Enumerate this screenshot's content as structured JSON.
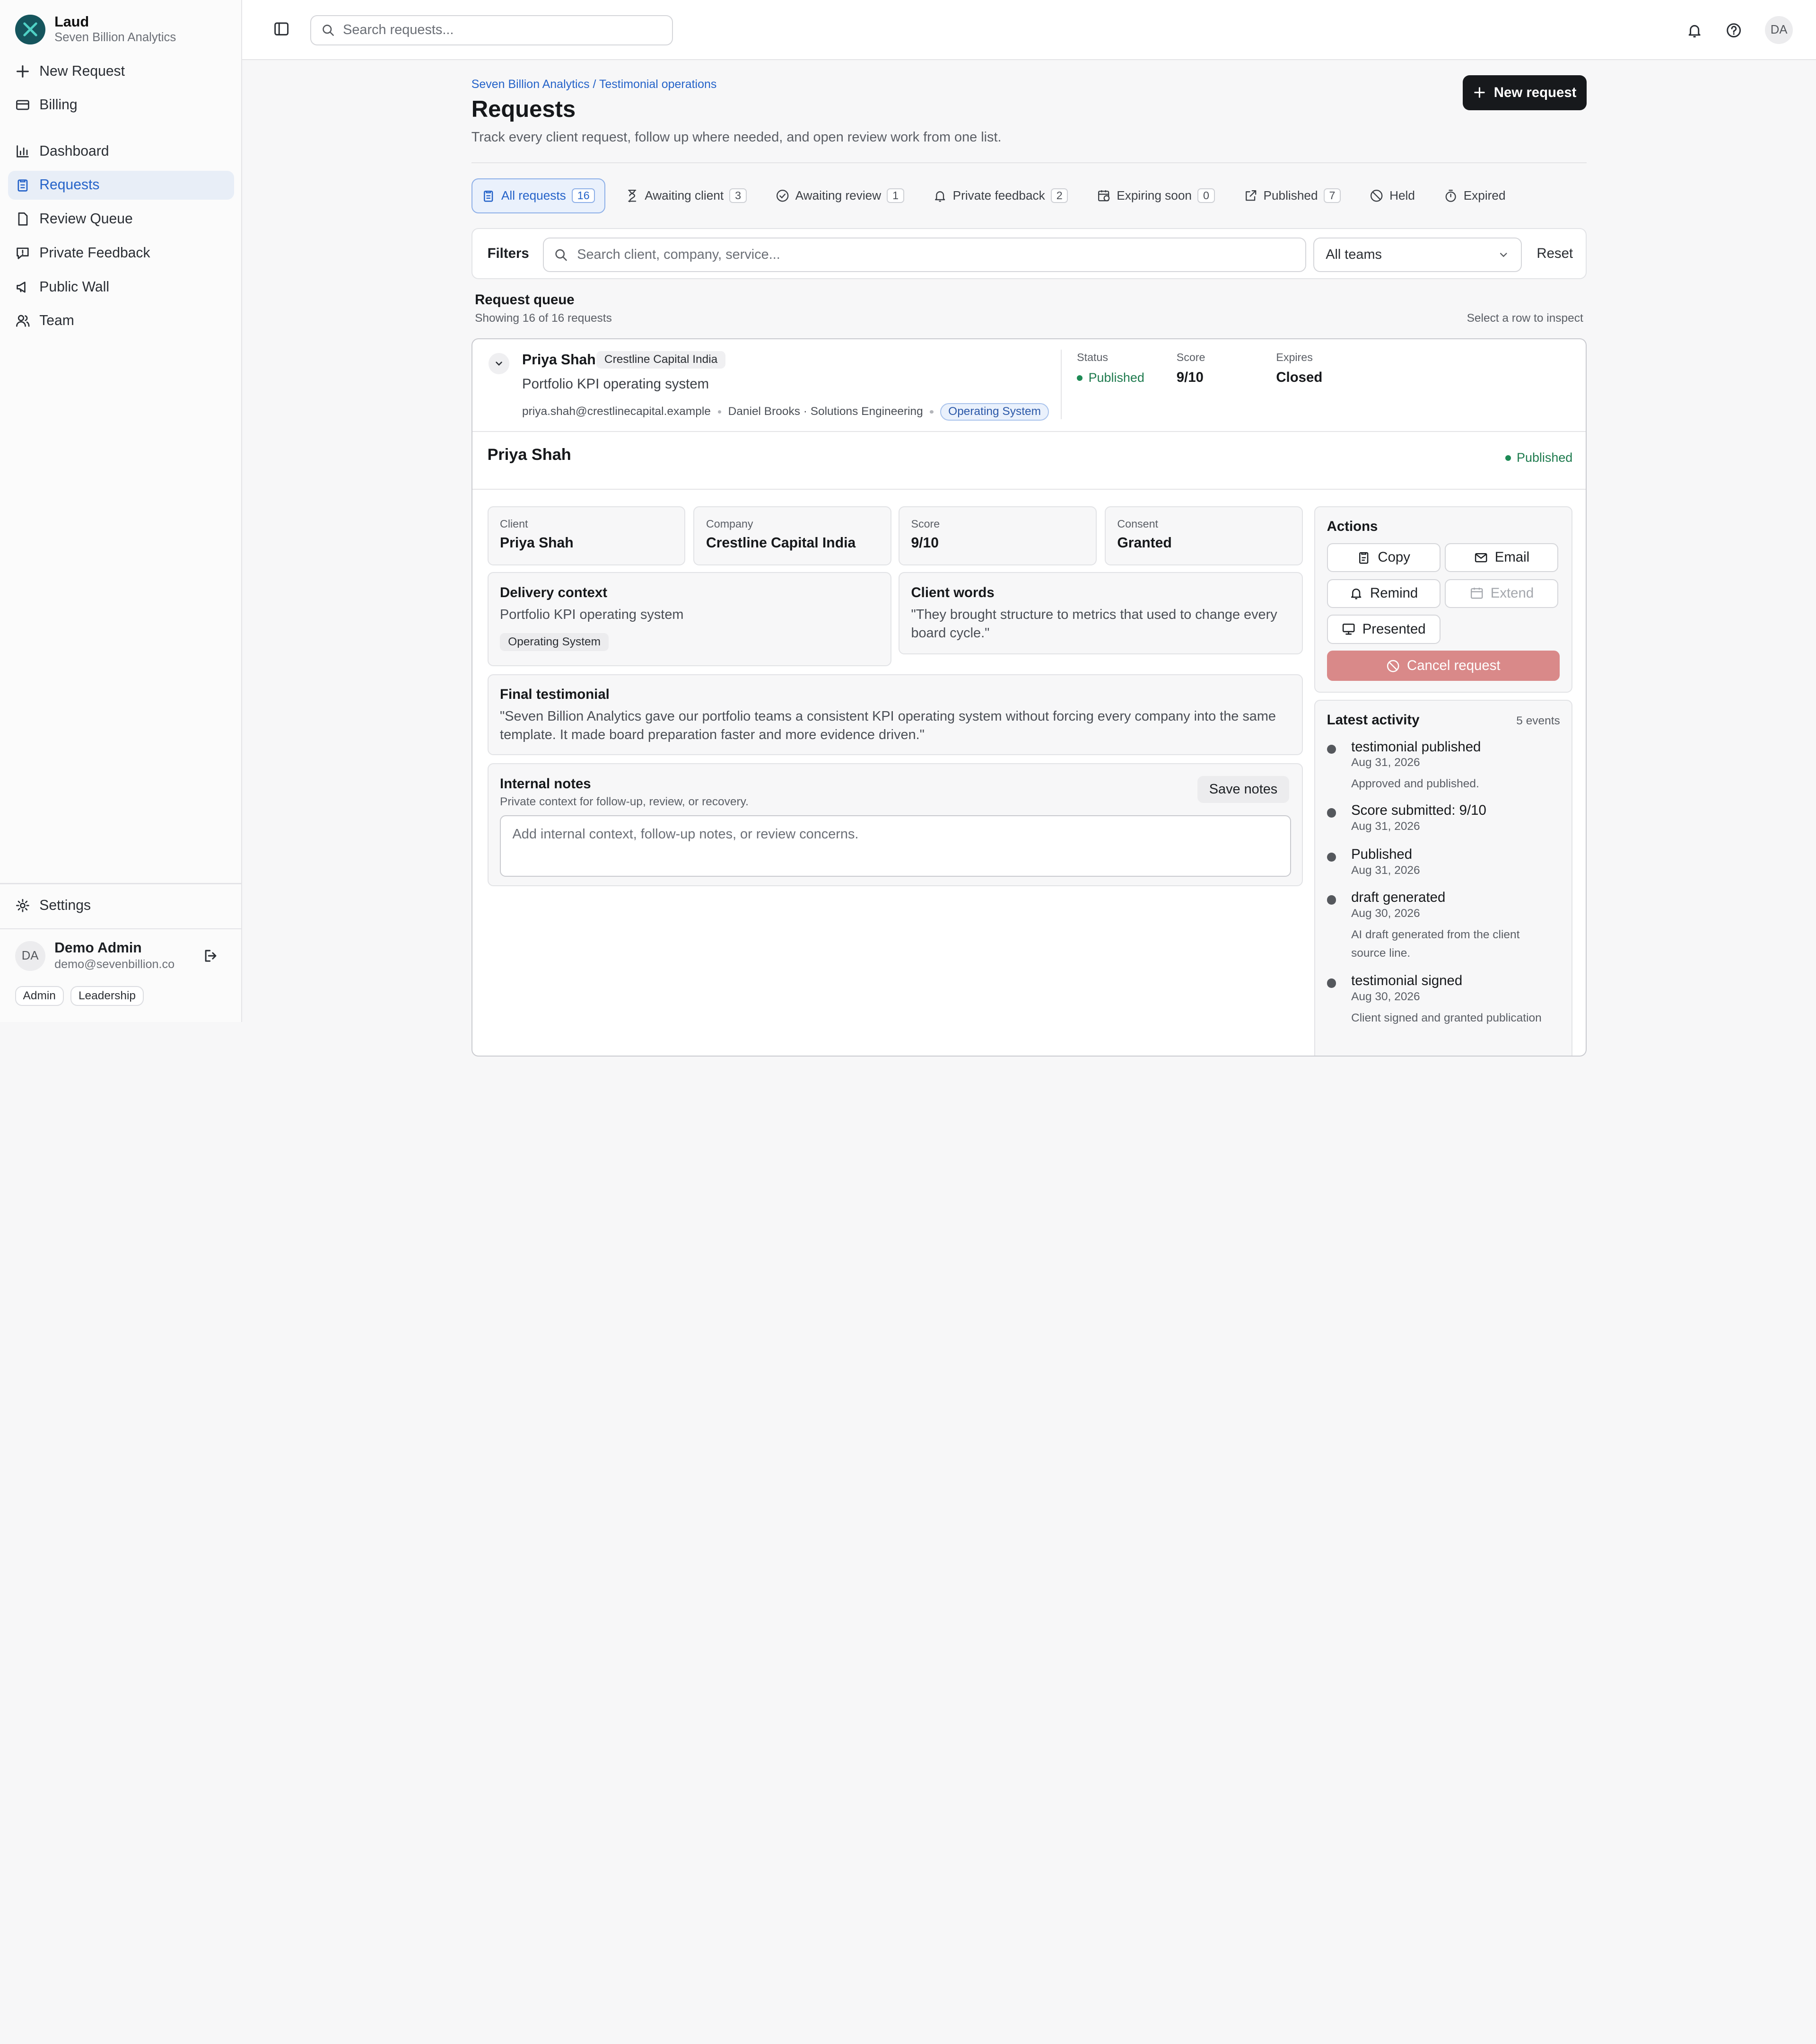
{
  "app": {
    "name": "Laud",
    "org": "Seven Billion Analytics"
  },
  "sidebar": {
    "top_items": [
      {
        "label": "New Request",
        "icon": "plus-icon"
      },
      {
        "label": "Billing",
        "icon": "credit-card-icon"
      }
    ],
    "items": [
      {
        "label": "Dashboard",
        "icon": "bar-chart-icon"
      },
      {
        "label": "Requests",
        "icon": "clipboard-icon",
        "active": true
      },
      {
        "label": "Review Queue",
        "icon": "file-icon"
      },
      {
        "label": "Private Feedback",
        "icon": "message-alert-icon"
      },
      {
        "label": "Public Wall",
        "icon": "megaphone-icon"
      },
      {
        "label": "Team",
        "icon": "users-icon"
      }
    ],
    "settings_label": "Settings",
    "user": {
      "initials": "DA",
      "name": "Demo Admin",
      "email": "demo@sevenbillion.co",
      "roles": [
        "Admin",
        "Leadership"
      ]
    }
  },
  "topbar": {
    "search_placeholder": "Search requests...",
    "avatar_initials": "DA"
  },
  "page": {
    "breadcrumb": "Seven Billion Analytics / Testimonial operations",
    "title": "Requests",
    "subtitle": "Track every client request, follow up where needed, and open review work from one list.",
    "new_button": "New request"
  },
  "tabs": [
    {
      "label": "All requests",
      "count": "16",
      "icon": "clipboard-icon",
      "active": true
    },
    {
      "label": "Awaiting client",
      "count": "3",
      "icon": "hourglass-icon"
    },
    {
      "label": "Awaiting review",
      "count": "1",
      "icon": "check-circle-icon"
    },
    {
      "label": "Private feedback",
      "count": "2",
      "icon": "bell-icon"
    },
    {
      "label": "Expiring soon",
      "count": "0",
      "icon": "calendar-clock-icon"
    },
    {
      "label": "Published",
      "count": "7",
      "icon": "external-link-icon"
    },
    {
      "label": "Held",
      "count": "",
      "icon": "ban-icon"
    },
    {
      "label": "Expired",
      "count": "",
      "icon": "timer-off-icon"
    }
  ],
  "filters": {
    "label": "Filters",
    "search_placeholder": "Search client, company, service...",
    "team": "All teams",
    "reset": "Reset"
  },
  "queue": {
    "title": "Request queue",
    "subtitle": "Showing 16 of 16 requests",
    "hint": "Select a row to inspect"
  },
  "request": {
    "name": "Priya Shah",
    "company": "Crestline Capital India",
    "service": "Portfolio KPI operating system",
    "email": "priya.shah@crestlinecapital.example",
    "owner": "Daniel Brooks · Solutions Engineering",
    "category": "Operating System",
    "status_label": "Status",
    "status": "Published",
    "score_label": "Score",
    "score": "9/10",
    "expires_label": "Expires",
    "expires": "Closed"
  },
  "detail": {
    "name": "Priya Shah",
    "status": "Published",
    "fields": [
      {
        "label": "Client",
        "value": "Priya Shah"
      },
      {
        "label": "Company",
        "value": "Crestline Capital India"
      },
      {
        "label": "Score",
        "value": "9/10"
      },
      {
        "label": "Consent",
        "value": "Granted"
      }
    ],
    "delivery_title": "Delivery context",
    "delivery_text": "Portfolio KPI operating system",
    "delivery_tag": "Operating System",
    "words_title": "Client words",
    "words_text": "\"They brought structure to metrics that used to change every board cycle.\"",
    "final_title": "Final testimonial",
    "final_text": "\"Seven Billion Analytics gave our portfolio teams a consistent KPI operating system without forcing every company into the same template. It made board preparation faster and more evidence driven.\"",
    "notes_title": "Internal notes",
    "notes_sub": "Private context for follow-up, review, or recovery.",
    "notes_placeholder": "Add internal context, follow-up notes, or review concerns.",
    "save_notes": "Save notes"
  },
  "actions": {
    "title": "Actions",
    "copy": "Copy",
    "email": "Email",
    "remind": "Remind",
    "extend": "Extend",
    "presented": "Presented",
    "cancel": "Cancel request"
  },
  "activity": {
    "title": "Latest activity",
    "count": "5 events",
    "events": [
      {
        "title": "testimonial published",
        "date": "Aug 31, 2026",
        "note": "Approved and published."
      },
      {
        "title": "Score submitted: 9/10",
        "date": "Aug 31, 2026",
        "note": ""
      },
      {
        "title": "Published",
        "date": "Aug 31, 2026",
        "note": ""
      },
      {
        "title": "draft generated",
        "date": "Aug 30, 2026",
        "note": "AI draft generated from the client source line."
      },
      {
        "title": "testimonial signed",
        "date": "Aug 30, 2026",
        "note": "Client signed and granted publication"
      }
    ]
  },
  "colors": {
    "accent": "#2563c9",
    "primary_button": "#17191c",
    "published_green": "#1d7a4d",
    "cancel_red": "#d98989",
    "brand_logo": "#15555d"
  }
}
